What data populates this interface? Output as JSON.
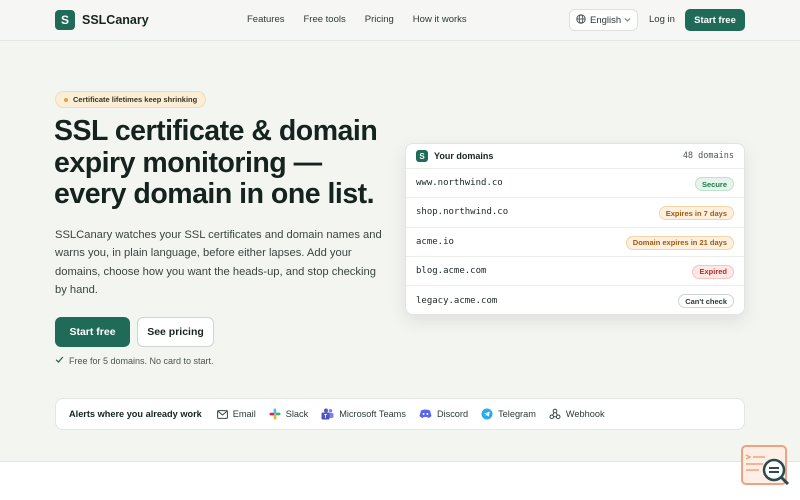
{
  "brand": {
    "name": "SSLCanary",
    "logo_letter": "S"
  },
  "nav": {
    "items": [
      "Features",
      "Free tools",
      "Pricing",
      "How it works"
    ],
    "language": "English",
    "login": "Log in",
    "start_free": "Start free"
  },
  "hero": {
    "badge": "Certificate lifetimes keep shrinking",
    "title": "SSL certificate & domain expiry monitoring — every domain in one list.",
    "description": "SSLCanary watches your SSL certificates and domain names and warns you, in plain language, before either lapses. Add your domains, choose how you want the heads-up, and stop checking by hand.",
    "cta_primary": "Start free",
    "cta_secondary": "See pricing",
    "free_note": "Free for 5 domains. No card to start."
  },
  "domains_card": {
    "title": "Your domains",
    "count": "48 domains",
    "rows": [
      {
        "domain": "www.northwind.co",
        "status": "Secure",
        "kind": "secure"
      },
      {
        "domain": "shop.northwind.co",
        "status": "Expires in 7 days",
        "kind": "warn"
      },
      {
        "domain": "acme.io",
        "status": "Domain expires in 21 days",
        "kind": "warn"
      },
      {
        "domain": "blog.acme.com",
        "status": "Expired",
        "kind": "expired"
      },
      {
        "domain": "legacy.acme.com",
        "status": "Can't check",
        "kind": "cant"
      }
    ]
  },
  "alerts": {
    "label": "Alerts where you already work",
    "channels": [
      {
        "name": "Email",
        "icon": "mail-icon"
      },
      {
        "name": "Slack",
        "icon": "slack-icon"
      },
      {
        "name": "Microsoft Teams",
        "icon": "teams-icon"
      },
      {
        "name": "Discord",
        "icon": "discord-icon"
      },
      {
        "name": "Telegram",
        "icon": "telegram-icon"
      },
      {
        "name": "Webhook",
        "icon": "webhook-icon"
      }
    ]
  },
  "colors": {
    "brand": "#1f6b58",
    "secure": "#1c7a4a",
    "warn": "#a05a12",
    "expired": "#b4302a"
  }
}
